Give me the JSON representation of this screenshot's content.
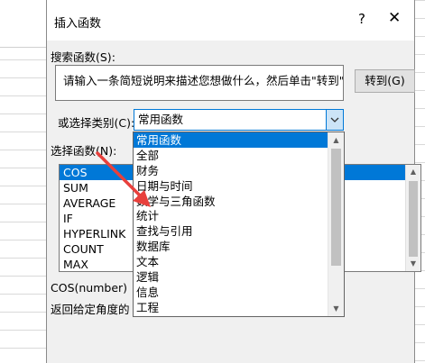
{
  "dialog": {
    "title": "插入函数",
    "help_label": "?",
    "close_label": "✕"
  },
  "search": {
    "label": "搜索函数(S):",
    "value": "请输入一条简短说明来描述您想做什么，然后单击\"转到\"",
    "goto_label": "转到(G)"
  },
  "category": {
    "label": "或选择类别(C):",
    "selected": "常用函数",
    "options": [
      "常用函数",
      "全部",
      "财务",
      "日期与时间",
      "数学与三角函数",
      "统计",
      "查找与引用",
      "数据库",
      "文本",
      "逻辑",
      "信息",
      "工程"
    ]
  },
  "functions": {
    "label": "选择函数(N):",
    "items": [
      "COS",
      "SUM",
      "AVERAGE",
      "IF",
      "HYPERLINK",
      "COUNT",
      "MAX"
    ],
    "selected_index": 0
  },
  "details": {
    "signature": "COS(number)",
    "description": "返回给定角度的"
  },
  "colors": {
    "accent": "#0078d7",
    "annotation_arrow": "#e8403c"
  }
}
